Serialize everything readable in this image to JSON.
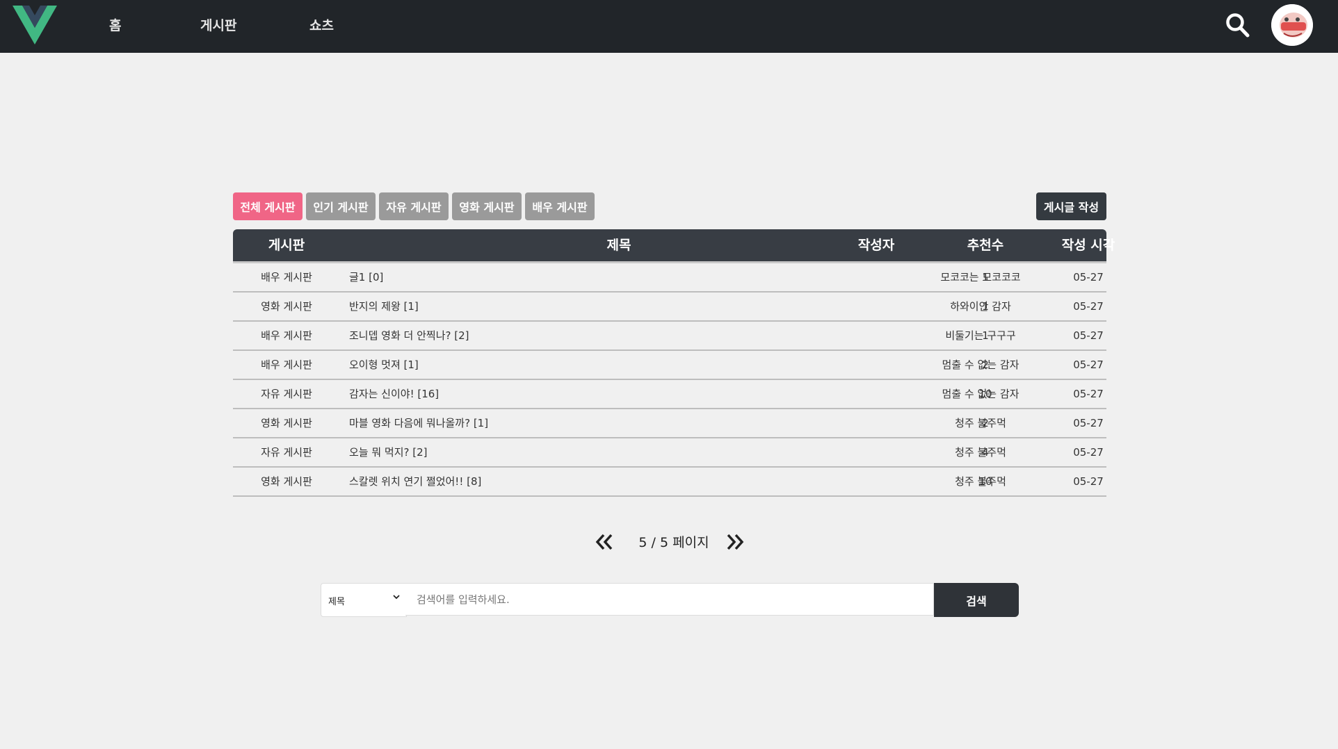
{
  "nav": {
    "items": [
      "홈",
      "게시판",
      "쇼츠"
    ]
  },
  "boards": {
    "tabs": [
      "전체 게시판",
      "인기 게시판",
      "자유 게시판",
      "영화 게시판",
      "배우 게시판"
    ],
    "active_tab": "전체 게시판",
    "write_label": "게시글 작성"
  },
  "table": {
    "headers": [
      "게시판",
      "제목",
      "작성자",
      "추천수",
      "작성 시각"
    ],
    "rows": [
      {
        "board": "배우 게시판",
        "title": "글1 [0]",
        "author": "모코코는 모코코코",
        "likes": "1",
        "time": "05-27"
      },
      {
        "board": "영화 게시판",
        "title": "반지의 제왕 [1]",
        "author": "하와이안 감자",
        "likes": "1",
        "time": "05-27"
      },
      {
        "board": "배우 게시판",
        "title": "조니뎁 영화 더 안찍나? [2]",
        "author": "비둘기는 구구구",
        "likes": "1",
        "time": "05-27"
      },
      {
        "board": "배우 게시판",
        "title": "오이형 멋져 [1]",
        "author": "멈출 수 없는 감자",
        "likes": "2",
        "time": "05-27"
      },
      {
        "board": "자유 게시판",
        "title": "감자는 신이야! [16]",
        "author": "멈출 수 없는 감자",
        "likes": "10",
        "time": "05-27"
      },
      {
        "board": "영화 게시판",
        "title": "마블 영화 다음에 뭐나올까? [1]",
        "author": "청주 불주먹",
        "likes": "2",
        "time": "05-27"
      },
      {
        "board": "자유 게시판",
        "title": "오늘 뭐 먹지? [2]",
        "author": "청주 불주먹",
        "likes": "4",
        "time": "05-27"
      },
      {
        "board": "영화 게시판",
        "title": "스칼렛 위치 연기 쩔었어!! [8]",
        "author": "청주 불주먹",
        "likes": "10",
        "time": "05-27"
      }
    ]
  },
  "pagination": {
    "label": "5 / 5 페이지",
    "current": 5,
    "total": 5
  },
  "search": {
    "field_selected": "제목",
    "placeholder": "검색어를 입력하세요.",
    "button_label": "검색"
  },
  "colors": {
    "topbar": "#212529",
    "active_tab": "#f06586",
    "inactive_tab": "#9a9a9a",
    "logo_outer": "#41b883",
    "logo_inner": "#35495e"
  },
  "icons": {
    "logo": "vue-logo-icon",
    "search": "search-icon",
    "prev": "double-chevron-left-icon",
    "next": "double-chevron-right-icon",
    "select": "chevron-down-icon"
  }
}
